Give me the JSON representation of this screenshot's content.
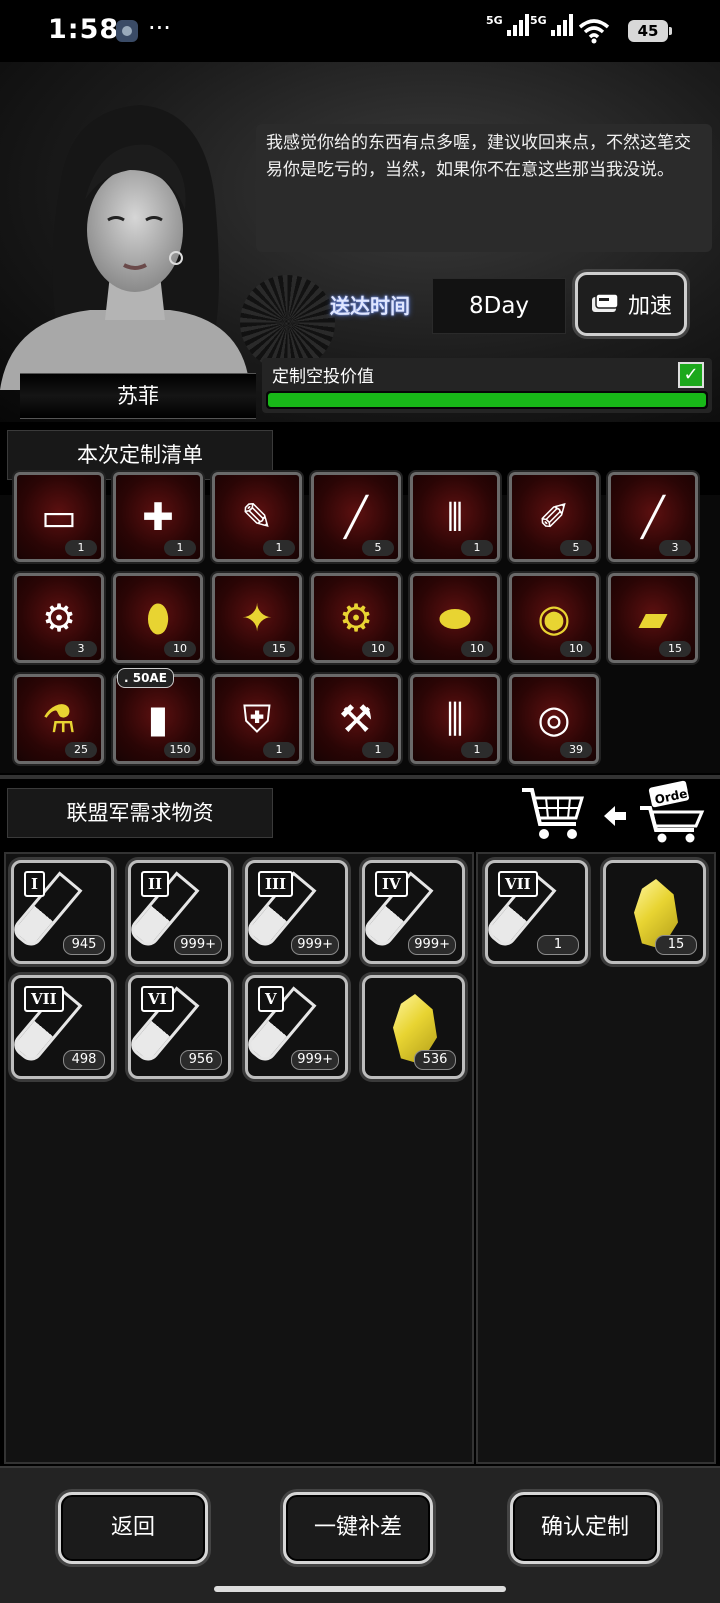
{
  "status_bar": {
    "time": "1:58",
    "more": "···",
    "network1": "5G",
    "network2": "5G",
    "battery": "45"
  },
  "character": {
    "name": "苏菲",
    "dialog": "我感觉你给的东西有点多喔，建议收回来点，不然这笔交易你是吃亏的，当然，如果你不在意这些那当我没说。"
  },
  "delivery": {
    "label": "送达时间",
    "value": "8Day",
    "speed_button": "加速"
  },
  "airdrop_value": {
    "label": "定制空投价值",
    "progress": 1.0,
    "checked": true
  },
  "custom_list": {
    "tab_label": "本次定制清单",
    "items": [
      {
        "icon": "battery-pack-icon",
        "glyph": "▭",
        "count": "1"
      },
      {
        "icon": "medkit-icon",
        "glyph": "✚",
        "count": "1"
      },
      {
        "icon": "syringe-plus-icon",
        "glyph": "✎",
        "count": "1"
      },
      {
        "icon": "syringe-long-icon",
        "glyph": "╱",
        "count": "5"
      },
      {
        "icon": "vials-icon",
        "glyph": "⫴",
        "count": "1"
      },
      {
        "icon": "injector-icon",
        "glyph": "✐",
        "count": "5"
      },
      {
        "icon": "stick-icon",
        "glyph": "╱",
        "count": "3"
      },
      {
        "icon": "circuit-board-icon",
        "glyph": "⚙",
        "count": "3"
      },
      {
        "icon": "pills-icon",
        "glyph": "⬮",
        "count": "10"
      },
      {
        "icon": "shards-icon",
        "glyph": "✦",
        "count": "15"
      },
      {
        "icon": "gear-parts-icon",
        "glyph": "⚙",
        "count": "10"
      },
      {
        "icon": "capsules-icon",
        "glyph": "⬬",
        "count": "10"
      },
      {
        "icon": "spool-icon",
        "glyph": "◉",
        "count": "10"
      },
      {
        "icon": "plates-icon",
        "glyph": "▰",
        "count": "15"
      },
      {
        "icon": "flask-icon",
        "glyph": "⚗",
        "count": "25"
      },
      {
        "icon": "ammo-cartridge-icon",
        "glyph": "▮",
        "count": "150",
        "badge": ". 50AE"
      },
      {
        "icon": "armor-vest-icon",
        "glyph": "⛨",
        "count": "1"
      },
      {
        "icon": "robot-parts-icon",
        "glyph": "⚒",
        "count": "1"
      },
      {
        "icon": "leg-guards-icon",
        "glyph": "⫼",
        "count": "1"
      },
      {
        "icon": "bandage-roll-icon",
        "glyph": "◎",
        "count": "39"
      }
    ]
  },
  "demand": {
    "tab_label": "联盟军需求物资",
    "inventory": [
      {
        "tier": "I",
        "type": "tube",
        "count": "945"
      },
      {
        "tier": "II",
        "type": "tube",
        "count": "999+"
      },
      {
        "tier": "III",
        "type": "tube",
        "count": "999+"
      },
      {
        "tier": "IV",
        "type": "tube",
        "count": "999+"
      },
      {
        "tier": "VII",
        "type": "tube",
        "count": "498"
      },
      {
        "tier": "VI",
        "type": "tube",
        "count": "956"
      },
      {
        "tier": "V",
        "type": "tube",
        "count": "999+"
      },
      {
        "tier": "",
        "type": "crystal",
        "count": "536"
      }
    ],
    "selected": [
      {
        "tier": "VII",
        "type": "tube",
        "count": "1"
      },
      {
        "tier": "",
        "type": "crystal",
        "count": "15"
      }
    ]
  },
  "cart_order_text": "Order",
  "footer": {
    "back": "返回",
    "fill_gap": "一键补差",
    "confirm": "确认定制"
  },
  "colors": {
    "progress": "#18b818",
    "slot_red": "#5c1010",
    "accent_yellow": "#e8d432"
  }
}
